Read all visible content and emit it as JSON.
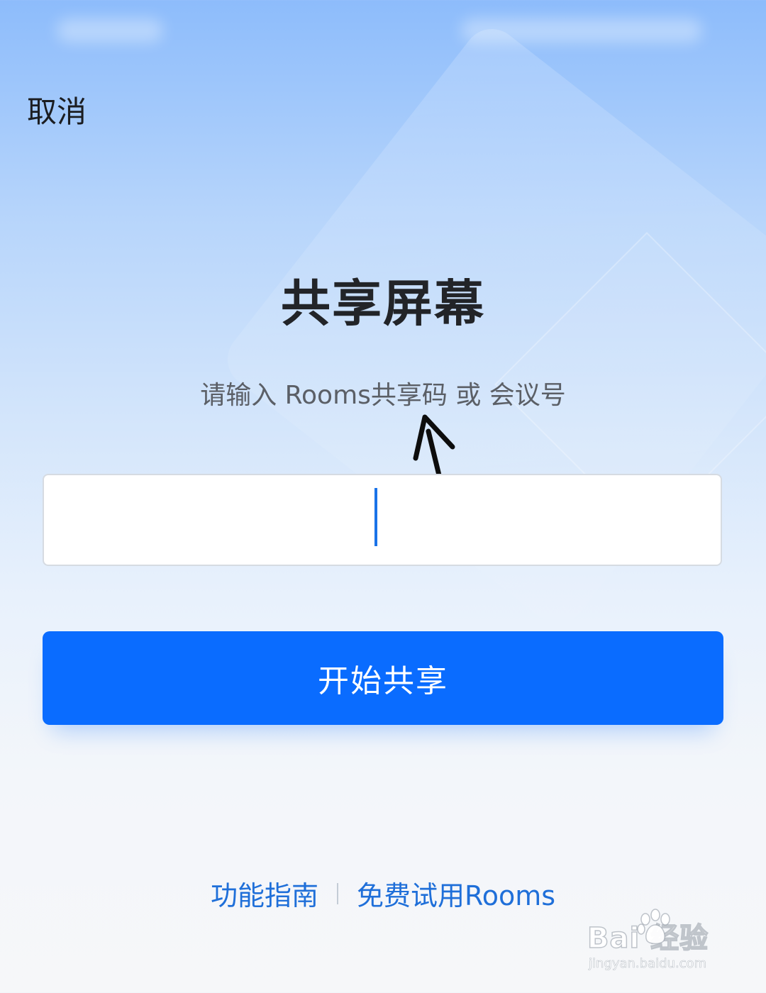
{
  "header": {
    "cancel_label": "取消"
  },
  "main": {
    "title": "共享屏幕",
    "subtitle": "请输入 Rooms共享码 或 会议号",
    "code_input": {
      "value": "",
      "placeholder": ""
    },
    "start_button_label": "开始共享"
  },
  "footer": {
    "links": [
      {
        "label": "功能指南"
      },
      {
        "label": "免费试用Rooms"
      }
    ]
  },
  "watermark": {
    "logo_text": "Bai 经验",
    "url": "jingyan.baidu.com"
  },
  "colors": {
    "primary_button": "#0a6cff",
    "link": "#1f6fd9",
    "cursor": "#1a73e8"
  },
  "icons": {
    "annotation": "arrow-up-icon",
    "watermark_logo": "paw-icon"
  }
}
